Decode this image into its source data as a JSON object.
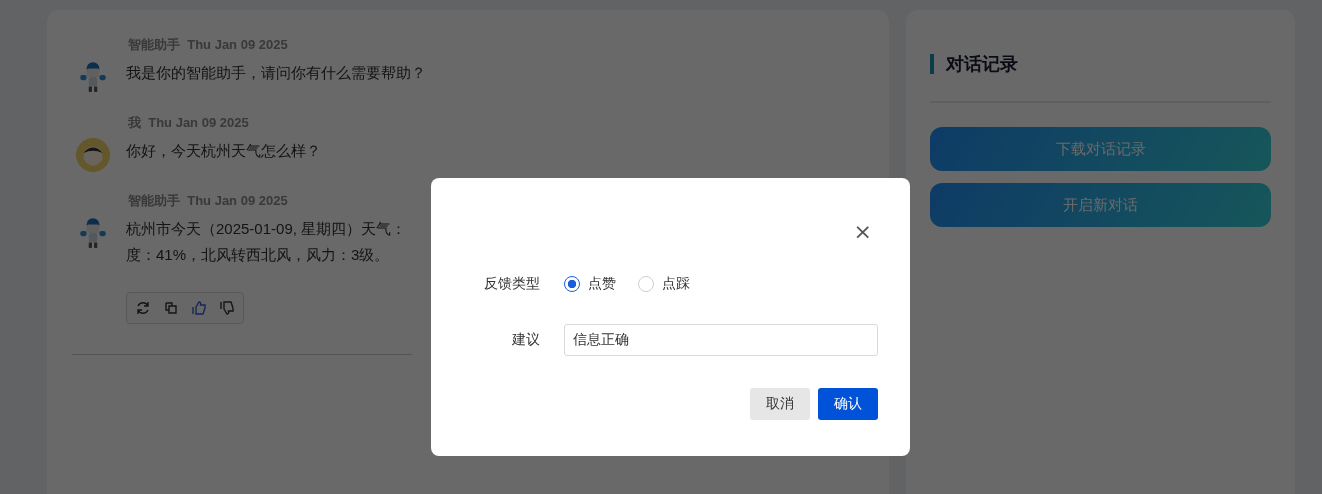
{
  "messages": [
    {
      "author": "智能助手",
      "date": "Thu Jan 09 2025",
      "kind": "bot",
      "lines": [
        "我是你的智能助手，请问你有什么需要帮助？"
      ]
    },
    {
      "author": "我",
      "date": "Thu Jan 09 2025",
      "kind": "user",
      "lines": [
        "你好，今天杭州天气怎么样？"
      ]
    },
    {
      "author": "智能助手",
      "date": "Thu Jan 09 2025",
      "kind": "bot",
      "lines": [
        "杭州市今天（2025-01-09, 星期四）天气：",
        "度：41%，北风转西北风，风力：3级。"
      ],
      "actions": [
        {
          "kind": "refresh",
          "selected": false
        },
        {
          "kind": "copy",
          "selected": false
        },
        {
          "kind": "like",
          "selected": true
        },
        {
          "kind": "dislike",
          "selected": false
        }
      ]
    }
  ],
  "sidebar": {
    "title": "对话记录",
    "buttons": [
      "下载对话记录",
      "开启新对话"
    ]
  },
  "dialog": {
    "close": "×",
    "type_label": "反馈类型",
    "options": [
      {
        "label": "点赞",
        "selected": true
      },
      {
        "label": "点踩",
        "selected": false
      }
    ],
    "suggestion_label": "建议",
    "suggestion_value": "信息正确",
    "buttons": [
      {
        "label": "取消",
        "kind": "secondary"
      },
      {
        "label": "确认",
        "kind": "primary"
      }
    ]
  }
}
